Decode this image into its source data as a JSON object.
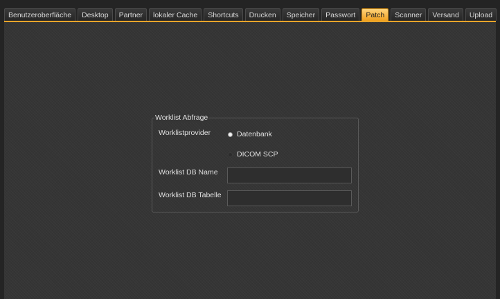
{
  "tabs": [
    {
      "label": "Benutzeroberfläche",
      "active": false
    },
    {
      "label": "Desktop",
      "active": false
    },
    {
      "label": "Partner",
      "active": false
    },
    {
      "label": "lokaler Cache",
      "active": false
    },
    {
      "label": "Shortcuts",
      "active": false
    },
    {
      "label": "Drucken",
      "active": false
    },
    {
      "label": "Speicher",
      "active": false
    },
    {
      "label": "Passwort",
      "active": false
    },
    {
      "label": "Patch",
      "active": true
    },
    {
      "label": "Scanner",
      "active": false
    },
    {
      "label": "Versand",
      "active": false
    },
    {
      "label": "Upload",
      "active": false
    }
  ],
  "colors": {
    "accent": "#f0a020",
    "background": "#353535"
  },
  "worklist": {
    "title": "Worklist Abfrage",
    "provider_label": "Worklistprovider",
    "options": [
      {
        "label": "Datenbank",
        "selected": true
      },
      {
        "label": "DICOM SCP",
        "selected": false
      }
    ],
    "db_name_label": "Worklist DB Name",
    "db_name_value": "",
    "db_table_label": "Worklist DB Tabelle",
    "db_table_value": ""
  }
}
